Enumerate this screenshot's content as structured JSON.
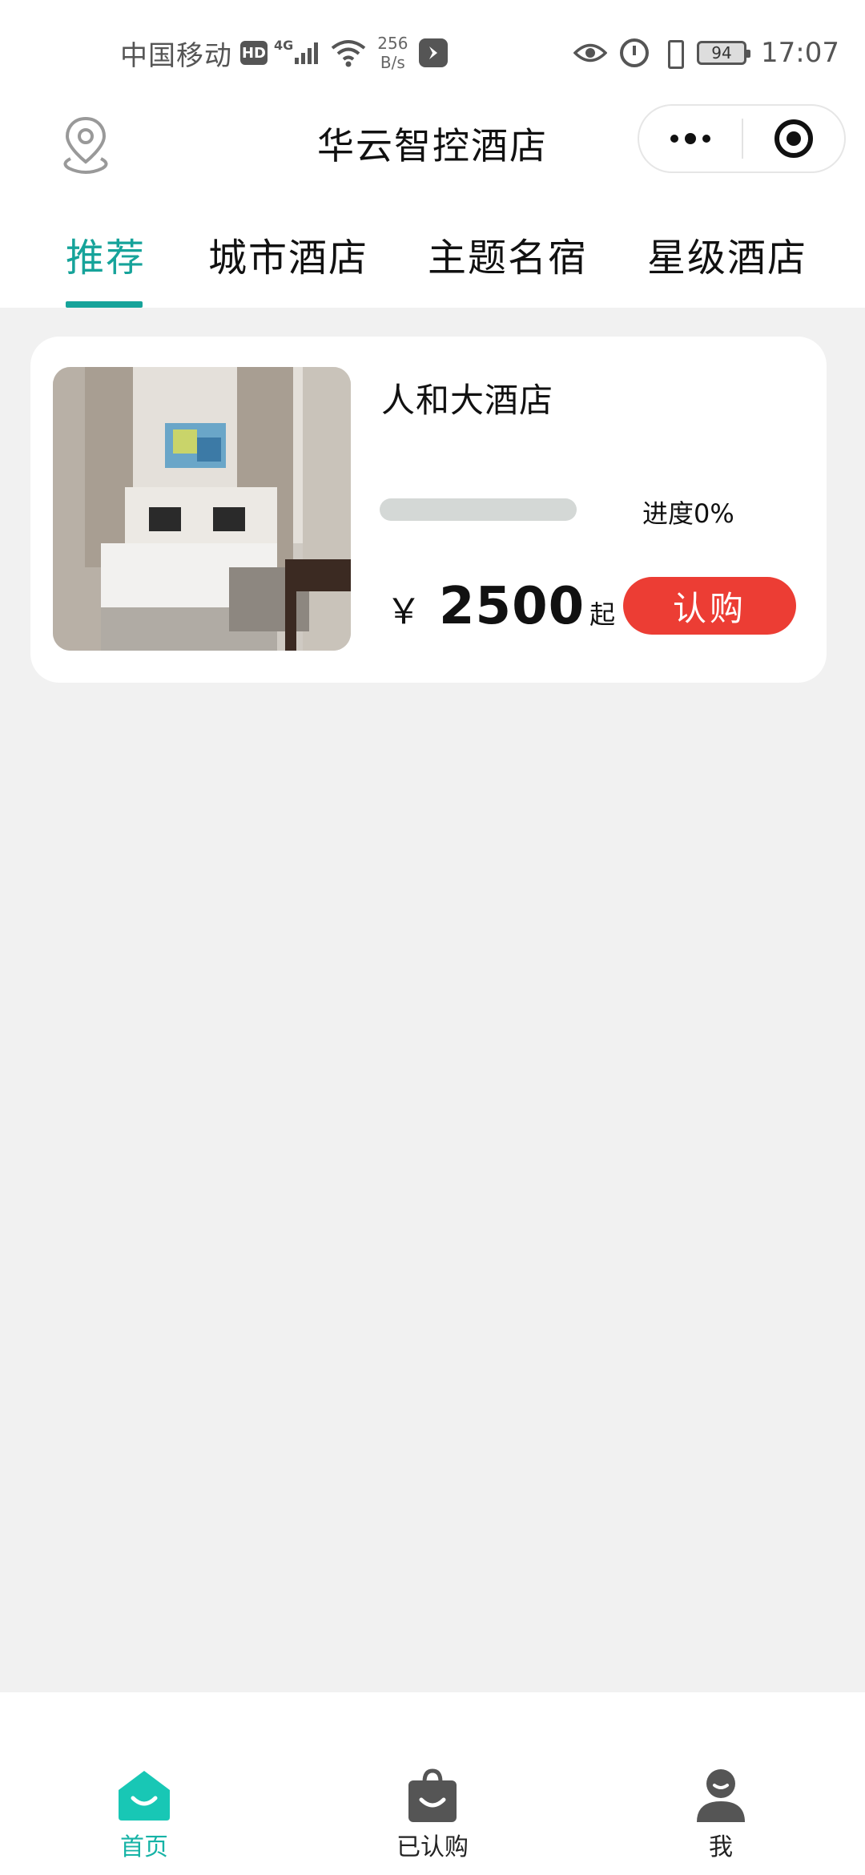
{
  "status_bar": {
    "carrier": "中国移动",
    "hd": "HD",
    "network": "4G",
    "speed_value": "256",
    "speed_unit": "B/s",
    "battery": "94",
    "time": "17:07"
  },
  "title_bar": {
    "title": "华云智控酒店"
  },
  "tabs": [
    {
      "label": "推荐",
      "active": true
    },
    {
      "label": "城市酒店",
      "active": false
    },
    {
      "label": "主题名宿",
      "active": false
    },
    {
      "label": "星级酒店",
      "active": false
    }
  ],
  "listing": {
    "name": "人和大酒店",
    "progress_percent": 0,
    "progress_label": "进度0%",
    "currency": "￥",
    "price": "2500",
    "price_suffix": "起",
    "buy_label": "认购"
  },
  "bottom_nav": [
    {
      "label": "首页",
      "icon": "home-icon",
      "active": true
    },
    {
      "label": "已认购",
      "icon": "shopping-bag-icon",
      "active": false
    },
    {
      "label": "我",
      "icon": "user-icon",
      "active": false
    }
  ],
  "colors": {
    "accent": "#16a39a",
    "buy_button": "#ec3d34",
    "background": "#f1f1f1"
  }
}
